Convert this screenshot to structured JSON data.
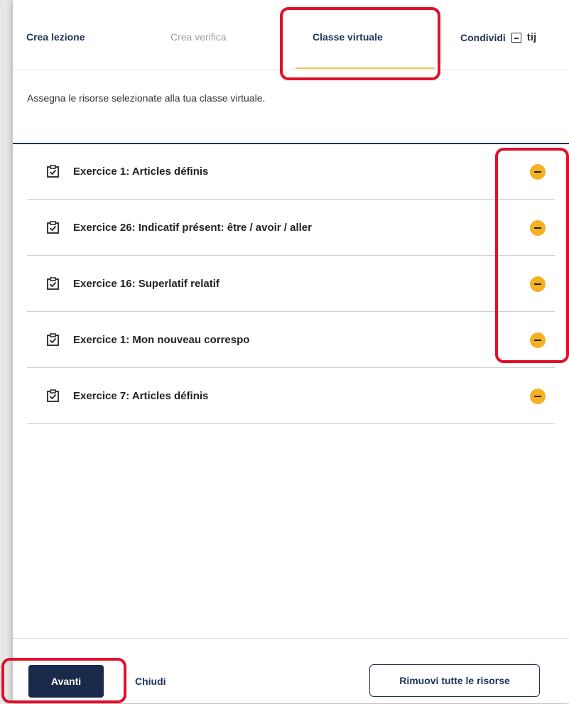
{
  "tabs": {
    "create_lesson": "Crea lezione",
    "create_test": "Crea verifica",
    "virtual_class": "Classe virtuale",
    "share": "Condividi",
    "teams_label": "tij"
  },
  "intro_text": "Assegna le risorse selezionate alla tua classe virtuale.",
  "resources": [
    {
      "label": "Exercice 1: Articles définis"
    },
    {
      "label": "Exercice 26: Indicatif présent: être / avoir / aller"
    },
    {
      "label": "Exercice 16: Superlatif relatif"
    },
    {
      "label": "Exercice 1: Mon nouveau correspo"
    },
    {
      "label": "Exercice 7: Articles définis"
    }
  ],
  "footer": {
    "next": "Avanti",
    "close": "Chiudi",
    "remove_all": "Rimuovi tutte le risorse"
  },
  "colors": {
    "accent": "#1d3557",
    "remove_icon": "#f4b223",
    "highlight": "#e0102a",
    "tab_underline": "#f2c14e"
  }
}
